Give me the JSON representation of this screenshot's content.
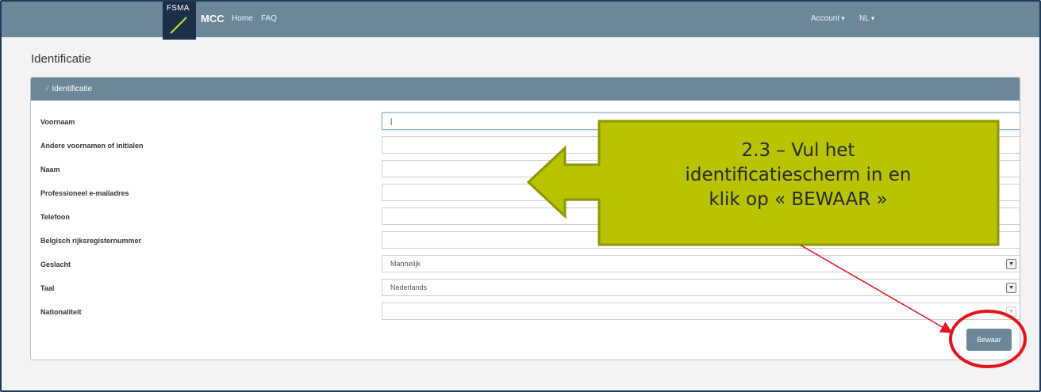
{
  "nav": {
    "logo_text": "FSMA",
    "brand": "MCC",
    "links": [
      "Home",
      "FAQ"
    ],
    "account_label": "Account",
    "language_label": "NL"
  },
  "page": {
    "title": "Identificatie"
  },
  "panel": {
    "title": "Identificatie",
    "fields": [
      {
        "label": "Voornaam",
        "value": "|"
      },
      {
        "label": "Andere voornamen of initialen",
        "value": ""
      },
      {
        "label": "Naam",
        "value": ""
      },
      {
        "label": "Professioneel e-mailadres",
        "value": ""
      },
      {
        "label": "Telefoon",
        "value": ""
      },
      {
        "label": "Belgisch rijksregisternummer",
        "value": ""
      },
      {
        "label": "Geslacht",
        "value": "Mannelijk"
      },
      {
        "label": "Taal",
        "value": "Nederlands"
      },
      {
        "label": "Nationaliteit",
        "value": ""
      }
    ],
    "save_label": "Bewaar"
  },
  "callout": {
    "lines": [
      "2.3 – Vul het",
      "identificatiescherm in en",
      "klik op « BEWAAR »"
    ]
  },
  "colors": {
    "navbar": "#6b8798",
    "logo_bg": "#1b2f47",
    "callout_fill": "#b9c400",
    "highlight": "#e3141e"
  },
  "icons": [
    "pencil-icon",
    "caret-down-icon",
    "select-arrow-icon"
  ]
}
